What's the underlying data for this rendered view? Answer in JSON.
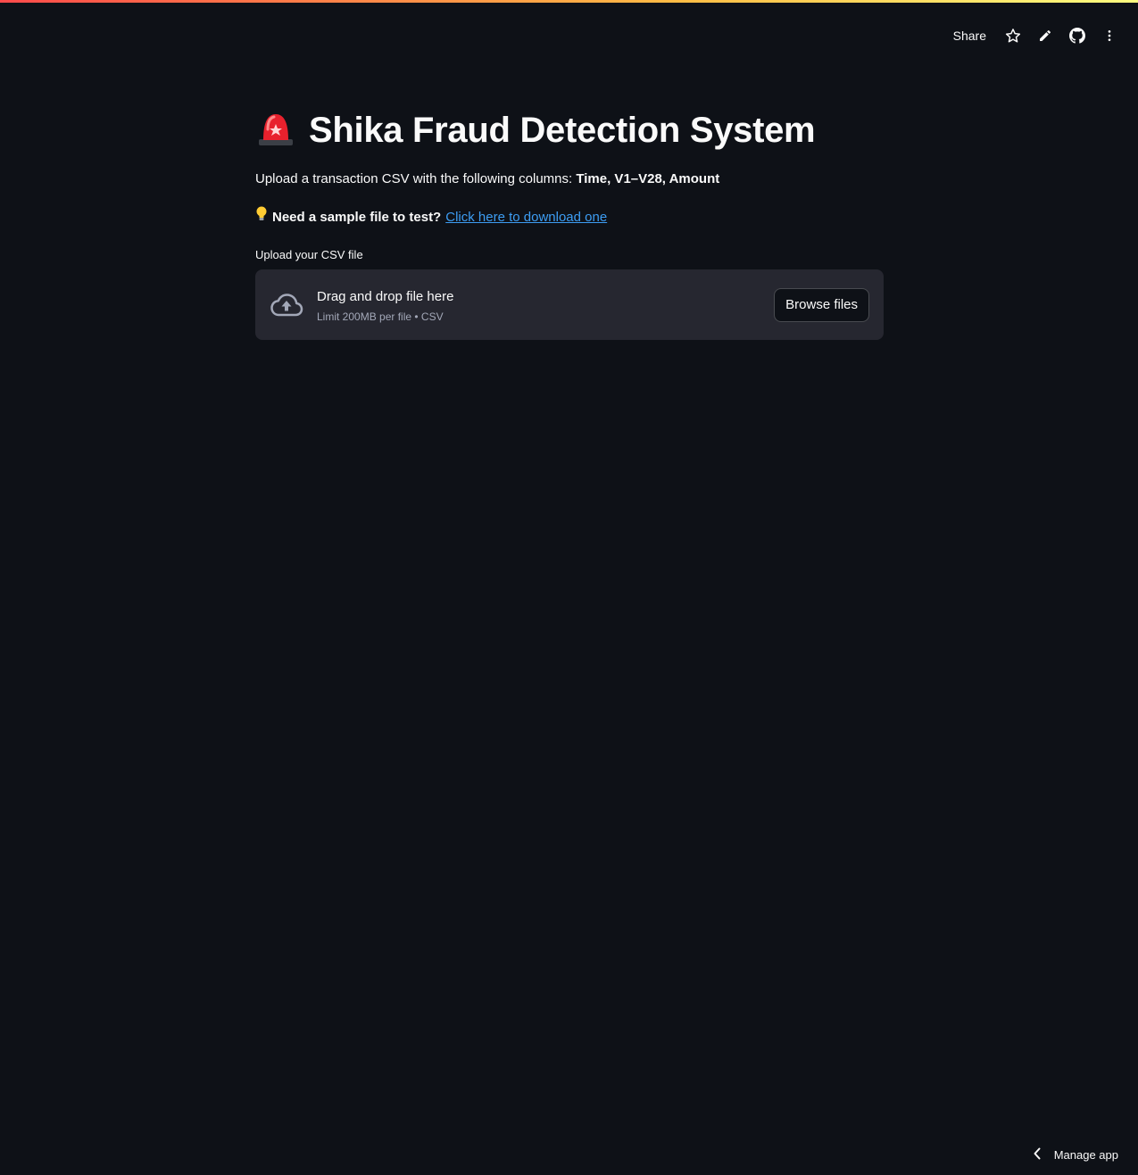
{
  "toolbar": {
    "share_label": "Share",
    "icons": [
      "star-icon",
      "pencil-icon",
      "github-icon",
      "kebab-menu-icon"
    ]
  },
  "main": {
    "title_emoji": "🚨",
    "title": "Shika Fraud Detection System",
    "description_prefix": "Upload a transaction CSV with the following columns: ",
    "description_columns": "Time, V1–V28, Amount",
    "sample_emoji": "💡",
    "sample_prompt": "Need a sample file to test?",
    "sample_link": "Click here to download one"
  },
  "uploader": {
    "label": "Upload your CSV file",
    "drop_text": "Drag and drop file here",
    "limit_text": "Limit 200MB per file • CSV",
    "browse_label": "Browse files"
  },
  "footer": {
    "manage_app_label": "Manage app"
  },
  "colors": {
    "background": "#0e1117",
    "dropzone": "#262730",
    "link": "#3d9df3"
  }
}
